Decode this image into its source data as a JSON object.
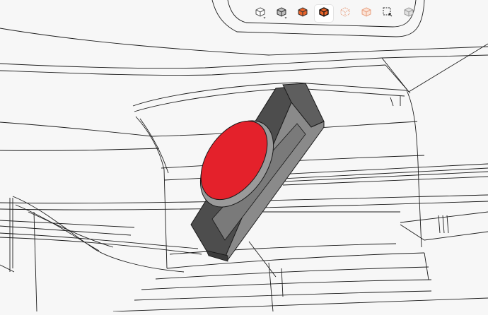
{
  "app": {
    "view_title": ""
  },
  "toolbar": {
    "buttons": [
      {
        "icon": "shaded-cube-icon",
        "active": false,
        "has_dropdown": true
      },
      {
        "icon": "shaded-edges-cube-icon",
        "active": false,
        "has_dropdown": true
      },
      {
        "icon": "orange-solid-cube-icon",
        "active": false,
        "has_dropdown": false
      },
      {
        "icon": "orange-selected-cube-icon",
        "active": true,
        "has_dropdown": false
      },
      {
        "icon": "wireframe-cube-icon",
        "active": false,
        "has_dropdown": false
      },
      {
        "icon": "light-cube-icon",
        "active": false,
        "has_dropdown": false
      },
      {
        "icon": "box-select-icon",
        "active": false,
        "has_dropdown": false
      },
      {
        "icon": "gray-cube-icon",
        "active": false,
        "has_dropdown": false
      }
    ]
  },
  "colors": {
    "background": "#f7f7f7",
    "wire": "#1c1c1c",
    "part_dark": "#4a4a4a",
    "part_mid": "#6b6b6b",
    "part_light": "#8a8a8a",
    "highlight_face": "#e4212b",
    "accent_orange": "#e8642a"
  }
}
